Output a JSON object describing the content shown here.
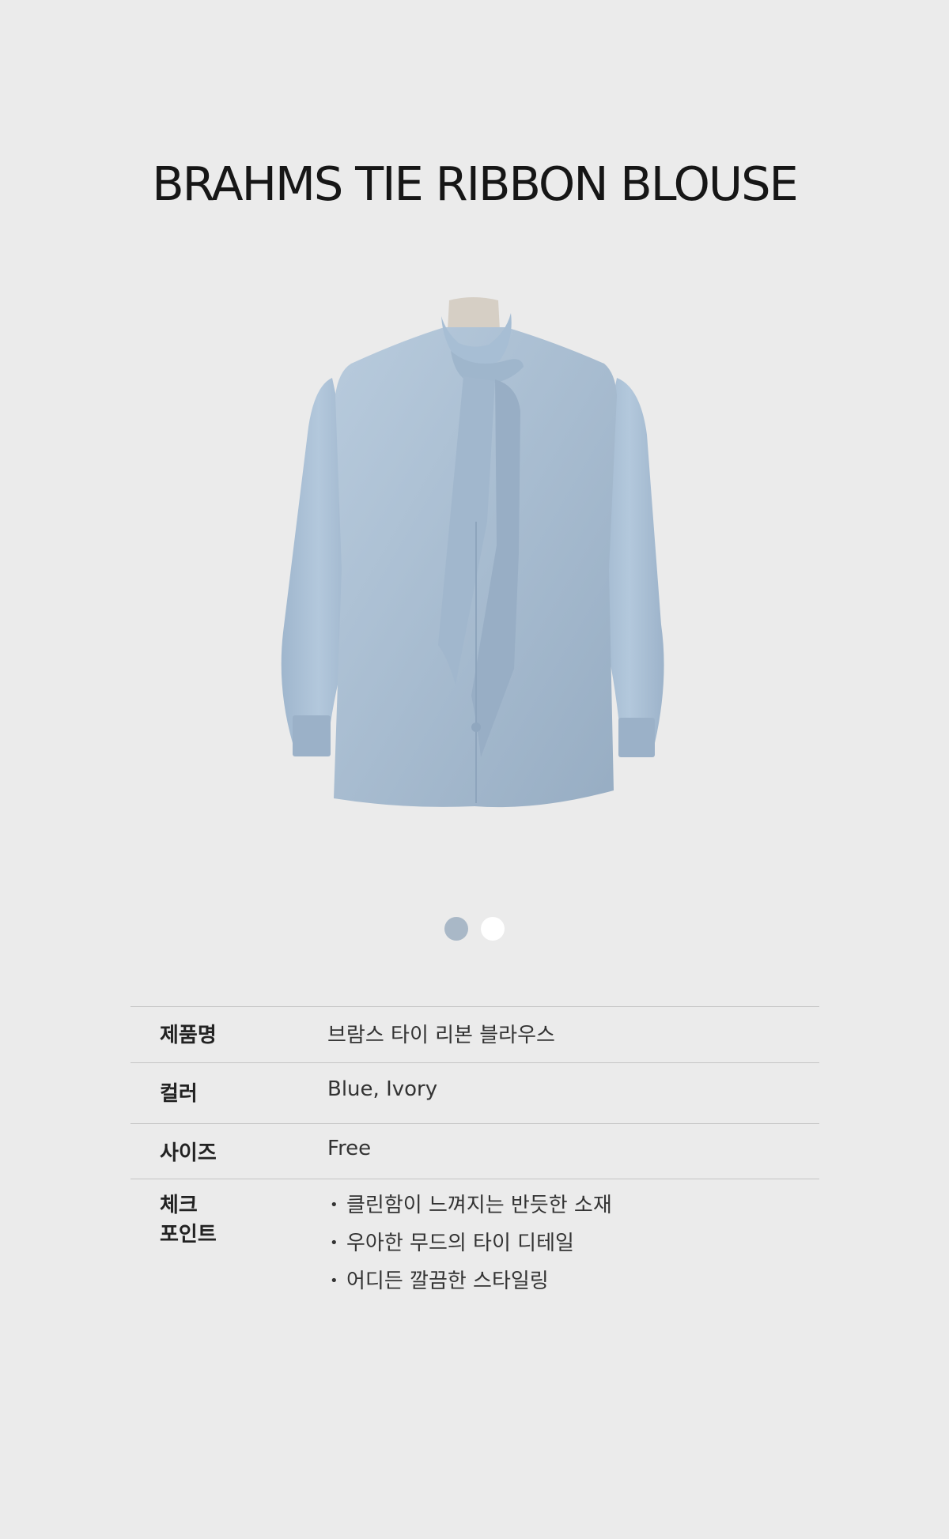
{
  "page": {
    "title": "BRAHMS TIE RIBBON BLOUSE",
    "background_color": "#ebebeb"
  },
  "product_image": {
    "alt": "product photo",
    "garment_color": "#a8bfd6"
  },
  "color_swatches": [
    {
      "name": "Blue",
      "hex": "#a9b8c7",
      "selected": true
    },
    {
      "name": "Ivory",
      "hex": "#ffffff",
      "selected": false
    }
  ],
  "spec_table": {
    "rows": [
      {
        "label": "제품명",
        "value": "브람스 타이 리본 블라우스"
      },
      {
        "label": "컬러",
        "value": "Blue, Ivory"
      },
      {
        "label": "사이즈",
        "value": "Free"
      },
      {
        "label_lines": [
          "체크",
          "포인트"
        ],
        "points": [
          "클린함이 느껴지는 반듯한 소재",
          "우아한 무드의 타이 디테일",
          "어디든 깔끔한 스타일링"
        ],
        "bullet": "•"
      }
    ]
  }
}
